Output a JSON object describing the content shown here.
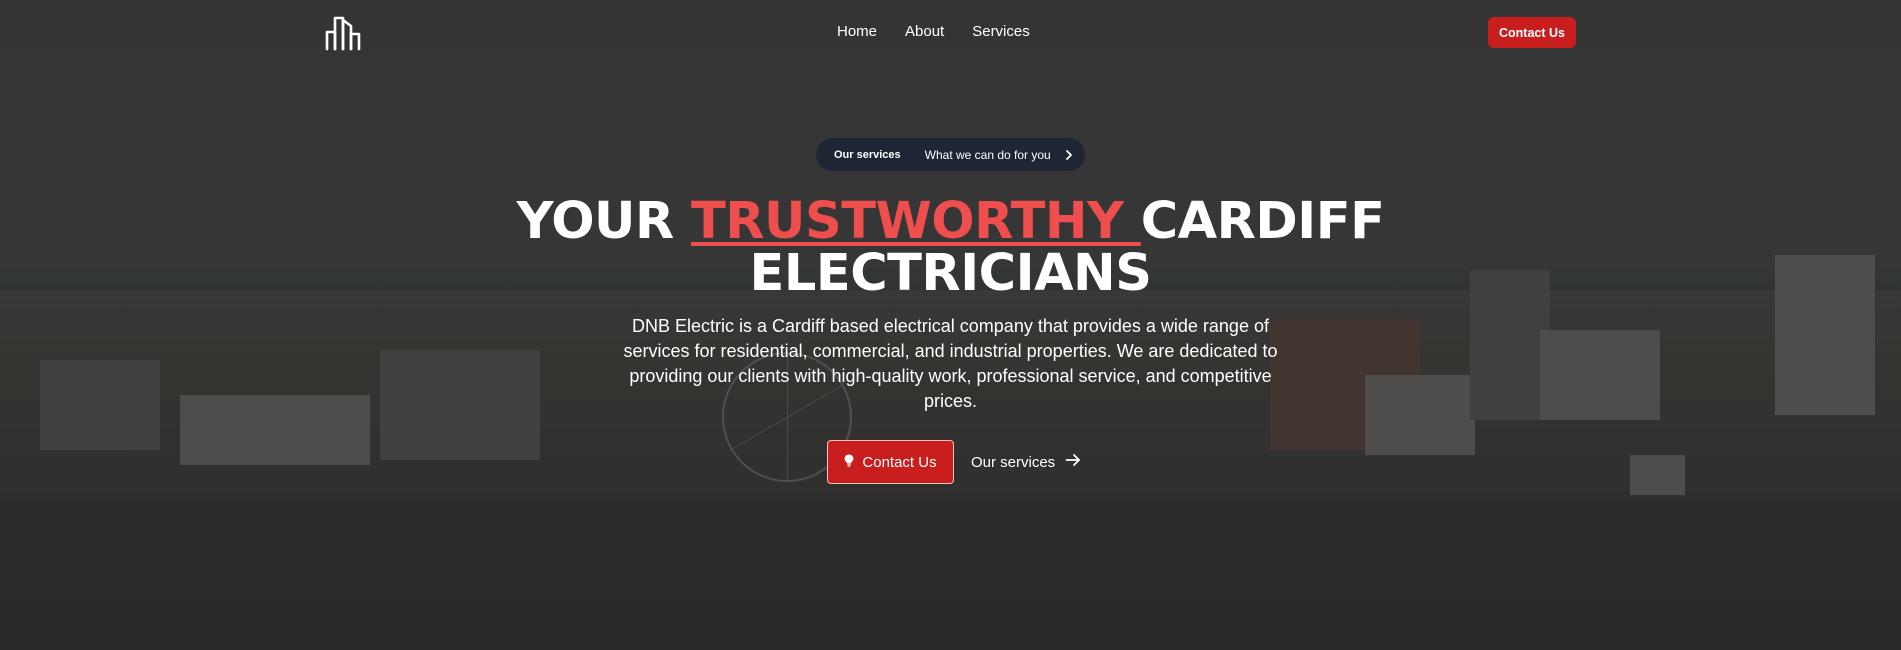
{
  "header": {
    "logo_alt": "DNB logo",
    "nav": [
      {
        "label": "Home"
      },
      {
        "label": "About"
      },
      {
        "label": "Services"
      }
    ],
    "cta_label": "Contact Us"
  },
  "hero": {
    "pill_tag": "Our services",
    "pill_text": "What we can do for you",
    "title_part1": "YOUR ",
    "title_accent": "TRUSTWORTHY ",
    "title_part2": "CARDIFF",
    "title_line2": "ELECTRICIANS",
    "description": "DNB Electric is a Cardiff based electrical company that provides a wide range of services for residential, commercial, and industrial properties. We are dedicated to providing our clients with high-quality work, professional service, and competitive prices.",
    "primary_button": "Contact Us",
    "secondary_button": "Our services"
  },
  "colors": {
    "accent": "#c81e1e",
    "highlight_text": "#ef4e4e",
    "pill_bg": "#1e2535"
  },
  "icons": {
    "logo": "dnb-building-logo-icon",
    "pill": "chevron-right-icon",
    "primary": "lightbulb-icon",
    "secondary": "arrow-right-icon"
  }
}
